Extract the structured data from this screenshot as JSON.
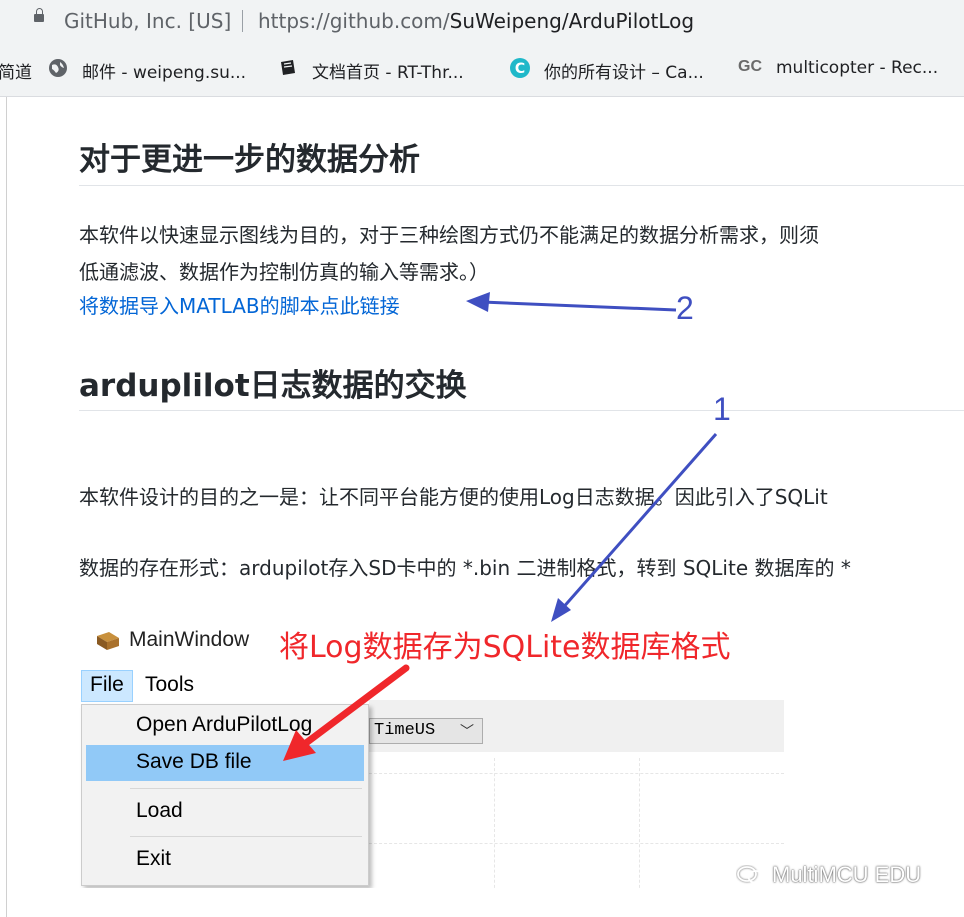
{
  "address_bar": {
    "site_identity": "GitHub, Inc. [US]",
    "url_prefix": "https://github.com/",
    "url_path": "SuWeipeng/ArduPilotLog"
  },
  "bookmarks": [
    {
      "label": "简道",
      "icon": "bookmark-fragment"
    },
    {
      "label": "邮件 - weipeng.su...",
      "icon": "globe-icon"
    },
    {
      "label": "文档首页 - RT-Thr...",
      "icon": "book-icon"
    },
    {
      "label": "你的所有设计 – Ca...",
      "icon": "canva-icon"
    },
    {
      "label": "multicopter - Rec...",
      "icon": "gc-icon",
      "icon_text": "GC"
    }
  ],
  "content": {
    "heading1": "对于更进一步的数据分析",
    "para1_line1": "本软件以快速显示图线为目的，对于三种绘图方式仍不能满足的数据分析需求，则须",
    "para1_line2": "低通滤波、数据作为控制仿真的输入等需求。）",
    "matlab_link": "将数据导入MATLAB的脚本点此链接",
    "heading2": "arduplilot日志数据的交换",
    "para2": "本软件设计的目的之一是：让不同平台能方便的使用Log日志数据。因此引入了SQLit",
    "para3": "数据的存在形式：ardupilot存入SD卡中的 *.bin 二进制格式，转到 SQLite 数据库的 *"
  },
  "annotations": {
    "number1": "1",
    "number2": "2",
    "red_note": "将Log数据存为SQLite数据库格式",
    "color_blue": "#3f4fc1",
    "color_red": "#f0272b"
  },
  "embedded_app": {
    "window_title": "MainWindow",
    "menu_file": "File",
    "menu_tools": "Tools",
    "file_menu_items": [
      "Open ArduPilotLog",
      "Save DB file",
      "Load",
      "Exit"
    ],
    "highlighted_item": "Save DB file",
    "combo_value": "TimeUS"
  },
  "watermark": "MultiMCU EDU"
}
